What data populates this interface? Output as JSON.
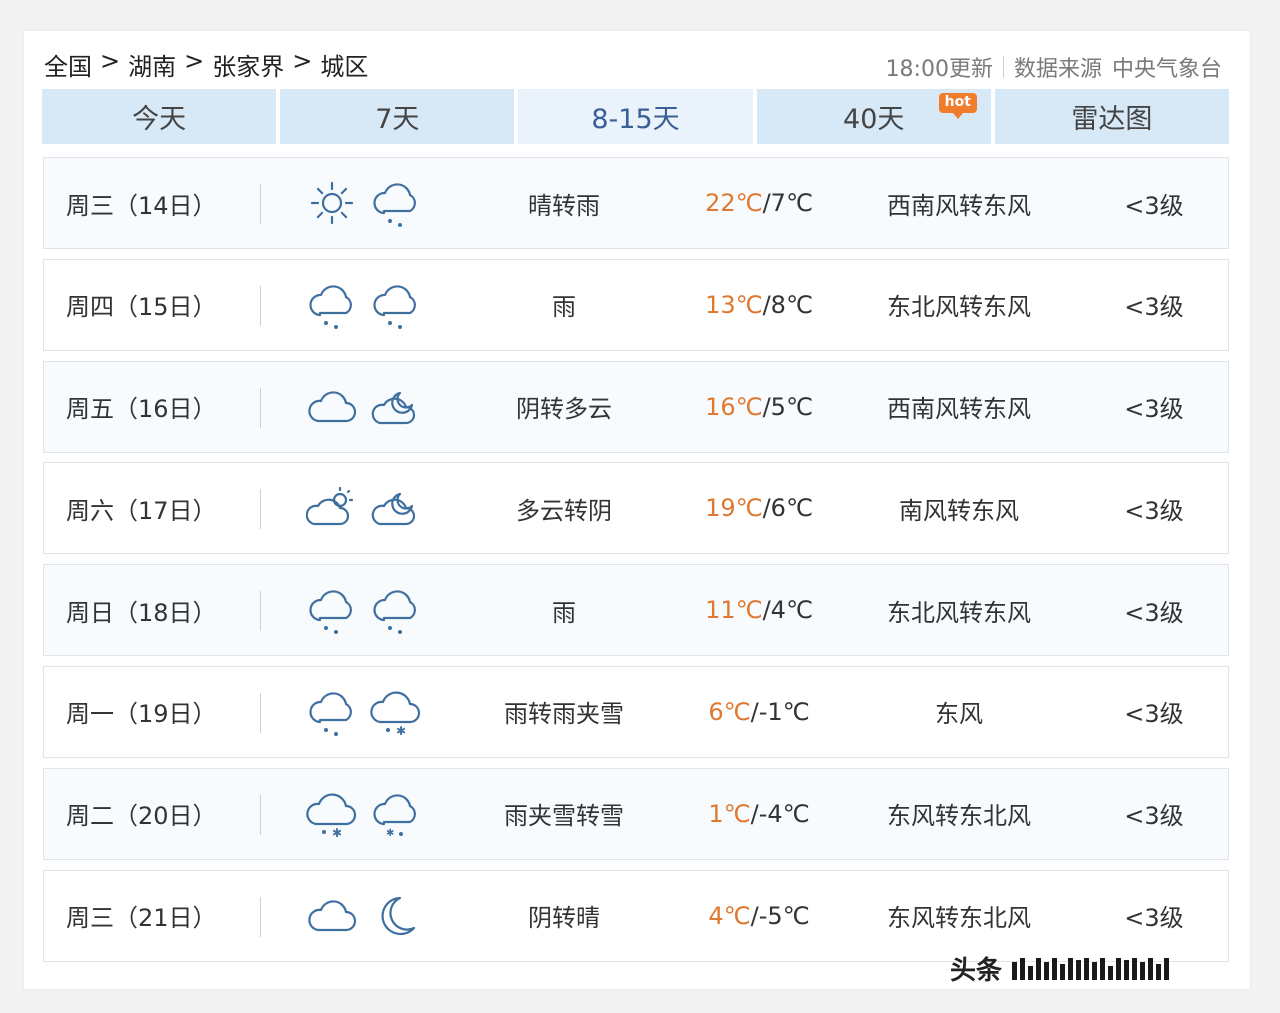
{
  "breadcrumb": [
    "全国",
    "湖南",
    "张家界",
    "城区"
  ],
  "breadcrumb_separator": ">",
  "update": {
    "time_text": "18:00更新",
    "source_label": "数据来源",
    "source": "中央气象台"
  },
  "tabs": [
    {
      "label": "今天",
      "active": false
    },
    {
      "label": "7天",
      "active": false
    },
    {
      "label": "8-15天",
      "active": true
    },
    {
      "label": "40天",
      "active": false,
      "badge": "hot"
    },
    {
      "label": "雷达图",
      "active": false
    }
  ],
  "colors": {
    "high_temp": "#e07830",
    "tab_bg": "#d7e8f7",
    "active_tab_text": "#3a5f96",
    "hot_badge": "#f07d2c"
  },
  "forecast": [
    {
      "date": "周三（14日）",
      "icons": [
        "sun-icon",
        "rain-cloud-icon"
      ],
      "desc": "晴转雨",
      "high": "22℃",
      "low": "/7℃",
      "wind": "西南风转东风",
      "level": "<3级"
    },
    {
      "date": "周四（15日）",
      "icons": [
        "rain-cloud-icon",
        "rain-cloud-icon"
      ],
      "desc": "雨",
      "high": "13℃",
      "low": "/8℃",
      "wind": "东北风转东风",
      "level": "<3级"
    },
    {
      "date": "周五（16日）",
      "icons": [
        "cloud-icon",
        "cloudy-night-icon"
      ],
      "desc": "阴转多云",
      "high": "16℃",
      "low": "/5℃",
      "wind": "西南风转东风",
      "level": "<3级"
    },
    {
      "date": "周六（17日）",
      "icons": [
        "partly-cloudy-day-icon",
        "cloudy-night-icon"
      ],
      "desc": "多云转阴",
      "high": "19℃",
      "low": "/6℃",
      "wind": "南风转东风",
      "level": "<3级"
    },
    {
      "date": "周日（18日）",
      "icons": [
        "rain-cloud-icon",
        "rain-cloud-icon"
      ],
      "desc": "雨",
      "high": "11℃",
      "low": "/4℃",
      "wind": "东北风转东风",
      "level": "<3级"
    },
    {
      "date": "周一（19日）",
      "icons": [
        "rain-cloud-icon",
        "sleet-cloud-icon"
      ],
      "desc": "雨转雨夹雪",
      "high": "6℃",
      "low": "/-1℃",
      "wind": "东风",
      "level": "<3级"
    },
    {
      "date": "周二（20日）",
      "icons": [
        "sleet-cloud-icon",
        "snow-cloud-icon"
      ],
      "desc": "雨夹雪转雪",
      "high": "1℃",
      "low": "/-4℃",
      "wind": "东风转东北风",
      "level": "<3级"
    },
    {
      "date": "周三（21日）",
      "icons": [
        "cloud-icon",
        "moon-icon"
      ],
      "desc": "阴转晴",
      "high": "4℃",
      "low": "/-5℃",
      "wind": "东风转东北风",
      "level": "<3级"
    }
  ],
  "watermark": "头条"
}
